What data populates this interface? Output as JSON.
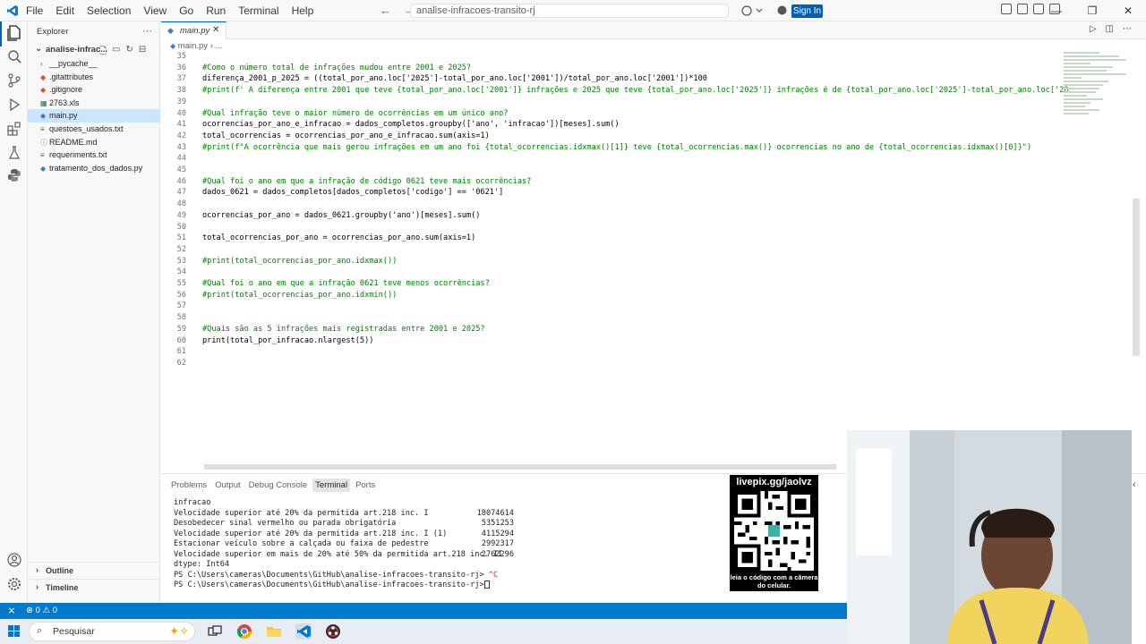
{
  "titlebar": {
    "menu": [
      "File",
      "Edit",
      "Selection",
      "View",
      "Go",
      "Run",
      "Terminal",
      "Help"
    ],
    "search_text": "analise-infracoes-transito-rj",
    "signin_label": "Sign In",
    "window_controls": [
      "—",
      "❐",
      "✕"
    ]
  },
  "sidebar": {
    "title": "Explorer",
    "folder": "analise-infrac...",
    "files": [
      {
        "name": "__pycache__",
        "kind": "folder"
      },
      {
        "name": ".gitattributes",
        "kind": "git"
      },
      {
        "name": ".gitignore",
        "kind": "git"
      },
      {
        "name": "2763.xls",
        "kind": "excel"
      },
      {
        "name": "main.py",
        "kind": "python"
      },
      {
        "name": "questoes_usados.txt",
        "kind": "text"
      },
      {
        "name": "README.md",
        "kind": "markdown"
      },
      {
        "name": "requeriments.txt",
        "kind": "text"
      },
      {
        "name": "tratamento_dos_dados.py",
        "kind": "python"
      }
    ],
    "outline": "Outline",
    "timeline": "Timeline"
  },
  "editor": {
    "tab": "main.py",
    "breadcrumb_file": "main.py",
    "breadcrumb_more": "...",
    "lines": [
      {
        "n": "35",
        "t": "",
        "k": "p"
      },
      {
        "n": "36",
        "t": "#Como o número total de infrações mudou entre 2001 e 2025?",
        "k": "c"
      },
      {
        "n": "37",
        "t": "diferença_2001_p_2025 = ((total_por_ano.loc['2025']-total_por_ano.loc['2001'])/total_por_ano.loc['2001'])*100",
        "k": "p"
      },
      {
        "n": "38",
        "t": "#print(f' A diferença entre 2001 que teve {total_por_ano.loc['2001']} infrações e 2025 que teve {total_por_ano.loc['2025']} infrações é de {total_por_ano.loc['2025']-total_por_ano.loc['20",
        "k": "c"
      },
      {
        "n": "39",
        "t": "",
        "k": "p"
      },
      {
        "n": "40",
        "t": "#Qual infração teve o maior número de ocorrências em um único ano?",
        "k": "c"
      },
      {
        "n": "41",
        "t": "ocorrencias_por_ano_e_infracao = dados_completos.groupby(['ano', 'infracao'])[meses].sum()",
        "k": "p"
      },
      {
        "n": "42",
        "t": "total_ocorrencias = ocorrencias_por_ano_e_infracao.sum(axis=1)",
        "k": "p"
      },
      {
        "n": "43",
        "t": "#print(f\"A ocorrência que mais gerou infrações em um ano foi {total_ocorrencias.idxmax()[1]} teve {total_ocorrencias.max()} ocorrencias no ano de {total_ocorrencias.idxmax()[0]}\")",
        "k": "c"
      },
      {
        "n": "44",
        "t": "",
        "k": "p"
      },
      {
        "n": "45",
        "t": "",
        "k": "p"
      },
      {
        "n": "46",
        "t": "#Qual foi o ano em que a infração de código 0621 teve mais ocorrências?",
        "k": "c"
      },
      {
        "n": "47",
        "t": "dados_0621 = dados_completos[dados_completos['codigo'] == '0621']",
        "k": "p"
      },
      {
        "n": "48",
        "t": "",
        "k": "p"
      },
      {
        "n": "49",
        "t": "ocorrencias_por_ano = dados_0621.groupby('ano')[meses].sum()",
        "k": "p"
      },
      {
        "n": "50",
        "t": "",
        "k": "p"
      },
      {
        "n": "51",
        "t": "total_ocorrencias_por_ano = ocorrencias_por_ano.sum(axis=1)",
        "k": "p"
      },
      {
        "n": "52",
        "t": "",
        "k": "p"
      },
      {
        "n": "53",
        "t": "#print(total_ocorrencias_por_ano.idxmax())",
        "k": "c"
      },
      {
        "n": "54",
        "t": "",
        "k": "p"
      },
      {
        "n": "55",
        "t": "#Qual foi o ano em que a infração 0621 teve menos ocorrências?",
        "k": "c"
      },
      {
        "n": "56",
        "t": "#print(total_ocorrencias_por_ano.idxmin())",
        "k": "c"
      },
      {
        "n": "57",
        "t": "",
        "k": "p"
      },
      {
        "n": "58",
        "t": "",
        "k": "p"
      },
      {
        "n": "59",
        "t": "#Quais são as 5 infrações mais registradas entre 2001 e 2025?",
        "k": "c"
      },
      {
        "n": "60",
        "t": "print(total_por_infracao.nlargest(5))",
        "k": "p"
      },
      {
        "n": "61",
        "t": "",
        "k": "p"
      },
      {
        "n": "62",
        "t": "",
        "k": "p"
      }
    ]
  },
  "panel": {
    "tabs": [
      "Problems",
      "Output",
      "Debug Console",
      "Terminal",
      "Ports"
    ],
    "active_tab": "Terminal",
    "terminal": {
      "header": "infracao",
      "rows": [
        {
          "label": "Velocidade superior até 20% da permitida art.218 inc. I",
          "value": "18074614"
        },
        {
          "label": "Desobedecer sinal vermelho ou parada obrigatória",
          "value": "5351253"
        },
        {
          "label": "Velocidade superior até 20% da permitida art.218 inc. I (1)",
          "value": "4115294"
        },
        {
          "label": "Estacionar veículo sobre a calçada ou faixa de pedestre",
          "value": "2992317"
        },
        {
          "label": "Velocidade superior em mais de 20% até 50% da permitida art.218 inc. II",
          "value": "2762296"
        }
      ],
      "dtype": "dtype: Int64",
      "prompt1": "PS C:\\Users\\cameras\\Documents\\GitHub\\analise-infracoes-transito-rj>",
      "ctrl": " ^C",
      "prompt2": "PS C:\\Users\\cameras\\Documents\\GitHub\\analise-infracoes-transito-rj>"
    }
  },
  "qr_overlay": {
    "top": "livepix.gg/jaolvz",
    "bottom": "leia o código com a câmera do celular."
  },
  "statusbar": {
    "errors": "0",
    "warnings": "0"
  },
  "taskbar": {
    "search_placeholder": "Pesquisar"
  }
}
